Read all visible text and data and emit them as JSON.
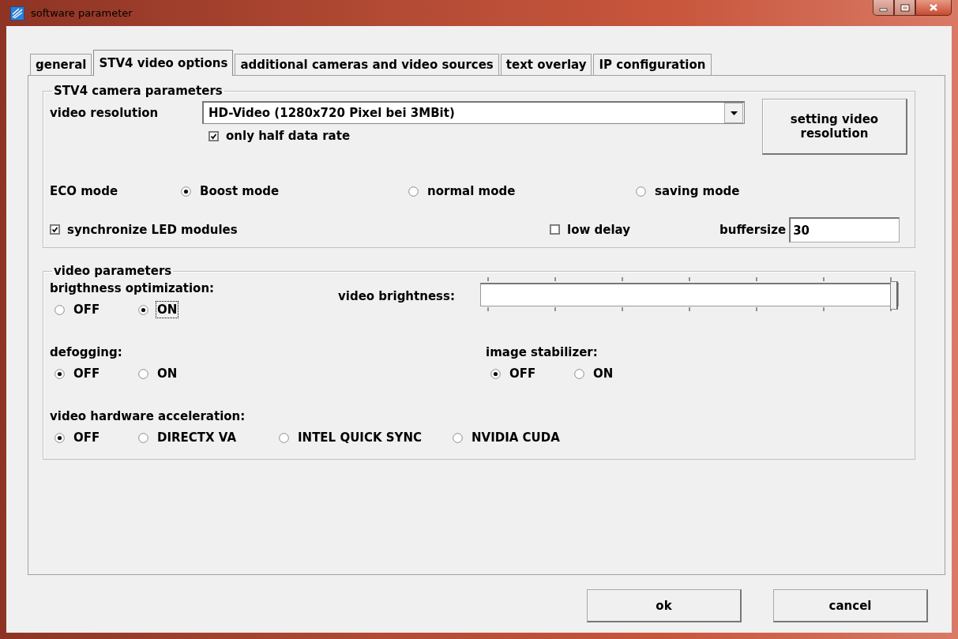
{
  "window": {
    "title": "software parameter"
  },
  "tabs": [
    {
      "label": "general",
      "selected": false
    },
    {
      "label": "STV4 video options",
      "selected": true
    },
    {
      "label": "additional cameras and video sources",
      "selected": false
    },
    {
      "label": "text overlay",
      "selected": false
    },
    {
      "label": "IP configuration",
      "selected": false
    }
  ],
  "camera_group": {
    "title": "STV4 camera parameters",
    "video_resolution": {
      "label": "video resolution",
      "value": "HD-Video (1280x720 Pixel bei 3MBit)"
    },
    "half_rate": {
      "label": "only half data rate",
      "checked": true
    },
    "setting_button": "setting video resolution",
    "eco_mode": {
      "label": "ECO mode",
      "options": [
        {
          "label": "Boost mode",
          "selected": true
        },
        {
          "label": "normal mode",
          "selected": false
        },
        {
          "label": "saving mode",
          "selected": false
        }
      ]
    },
    "sync_led": {
      "label": "synchronize LED modules",
      "checked": true
    },
    "low_delay": {
      "label": "low delay",
      "checked": false
    },
    "buffersize": {
      "label": "buffersize",
      "value": "30"
    }
  },
  "video_group": {
    "title": "video parameters",
    "brightness_optimization": {
      "label": "brigthness optimization:",
      "options": [
        {
          "label": "OFF",
          "selected": false,
          "focused": false
        },
        {
          "label": "ON",
          "selected": true,
          "focused": true
        }
      ]
    },
    "video_brightness": {
      "label": "video brightness:",
      "level": 1
    },
    "defogging": {
      "label": "defogging:",
      "options": [
        {
          "label": "OFF",
          "selected": true
        },
        {
          "label": "ON",
          "selected": false
        }
      ]
    },
    "image_stabilizer": {
      "label": "image stabilizer:",
      "options": [
        {
          "label": "OFF",
          "selected": true
        },
        {
          "label": "ON",
          "selected": false
        }
      ]
    },
    "hardware_acceleration": {
      "label": "video hardware acceleration:",
      "options": [
        {
          "label": "OFF",
          "selected": true
        },
        {
          "label": "DIRECTX VA",
          "selected": false
        },
        {
          "label": "INTEL QUICK SYNC",
          "selected": false
        },
        {
          "label": "NVIDIA CUDA",
          "selected": false
        }
      ]
    }
  },
  "buttons": [
    "ok",
    "cancel"
  ]
}
